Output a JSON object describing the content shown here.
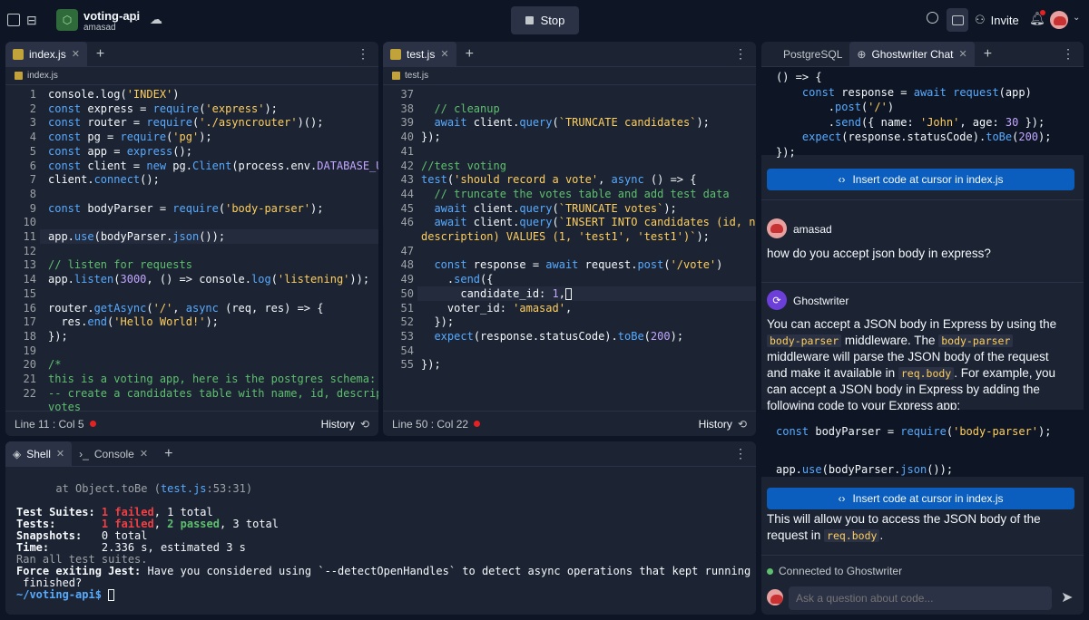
{
  "header": {
    "repl_name": "voting-api",
    "owner": "amasad",
    "stop_label": "Stop",
    "invite_label": "Invite"
  },
  "editor_left": {
    "tab": "index.js",
    "breadcrumb": "index.js",
    "status_pos": "Line 11 : Col 5",
    "history": "History",
    "line_numbers": [
      "1",
      "2",
      "3",
      "4",
      "5",
      "6",
      "7",
      "8",
      "9",
      "10",
      "11",
      "12",
      "13",
      "14",
      "15",
      "16",
      "17",
      "18",
      "19",
      "20",
      "21",
      "22"
    ]
  },
  "editor_right": {
    "tab": "test.js",
    "breadcrumb": "test.js",
    "status_pos": "Line 50 : Col 22",
    "history": "History",
    "line_numbers": [
      "37",
      "38",
      "39",
      "40",
      "41",
      "42",
      "43",
      "44",
      "45",
      "46",
      "47",
      "48",
      "49",
      "50",
      "51",
      "52",
      "53",
      "54",
      "55"
    ]
  },
  "console_pane": {
    "tab_shell": "Shell",
    "tab_console": "Console",
    "prompt": "~/voting-api$"
  },
  "chat_pane": {
    "tab_postgres": "PostgreSQL",
    "tab_chat": "Ghostwriter Chat",
    "insert_label": "Insert code at cursor in index.js",
    "user_name": "amasad",
    "user_message": "how do you accept json body in express?",
    "bot_name": "Ghostwriter",
    "connected": "Connected to Ghostwriter",
    "input_placeholder": "Ask a question about code..."
  },
  "colors": {
    "accent": "#0b5ebd",
    "bg": "#0e1525",
    "surface": "#1c2333",
    "error": "#e52222"
  }
}
